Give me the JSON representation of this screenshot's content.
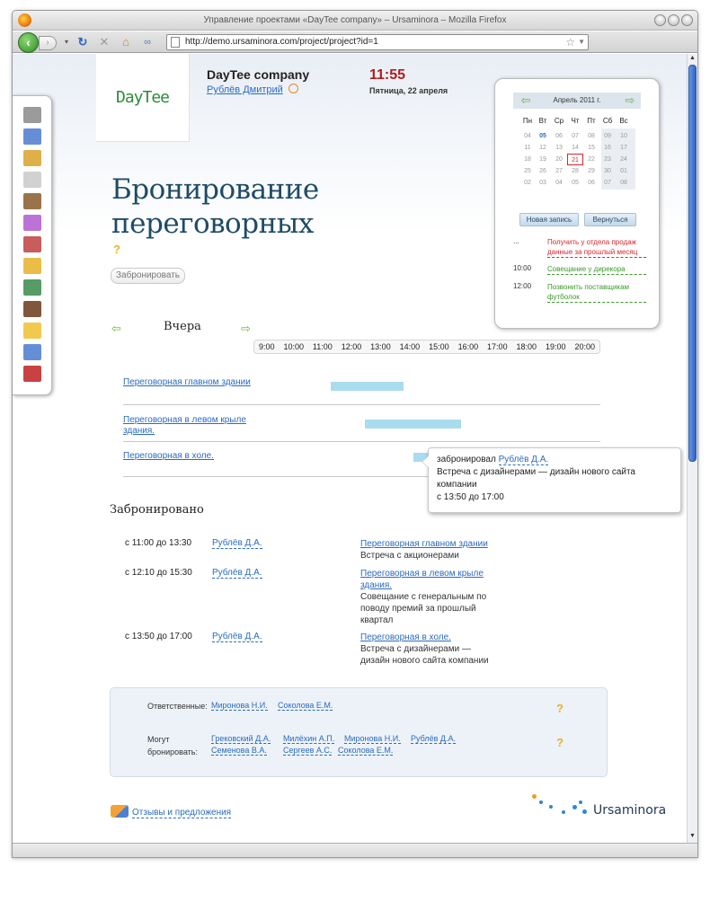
{
  "window": {
    "title": "Управление проектами «DayTee company» – Ursaminora – Mozilla Firefox",
    "url": "http://demo.ursaminora.com/project/project?id=1"
  },
  "header": {
    "logo": "DayTee",
    "company": "DayTee company",
    "user": "Рублёв Дмитрий",
    "time": "11:55",
    "date": "Пятница, 22 апреля"
  },
  "sidebar": {
    "icons": [
      "news-icon",
      "messages-icon",
      "users-icon",
      "document-icon",
      "books-icon",
      "coffee-icon",
      "truck-icon",
      "clipboard-icon",
      "binders-icon",
      "notebook-icon",
      "mail-icon",
      "contact-card-icon",
      "new-badge-icon"
    ]
  },
  "page": {
    "title": "Бронирование переговорных",
    "help": "?",
    "book_button": "Забронировать"
  },
  "schedule": {
    "day": "Вчера",
    "hours": [
      "9:00",
      "10:00",
      "11:00",
      "12:00",
      "13:00",
      "14:00",
      "15:00",
      "16:00",
      "17:00",
      "18:00",
      "19:00",
      "20:00"
    ],
    "rooms": [
      {
        "name": "Переговорная главном здании",
        "start": 11,
        "end": 13.5
      },
      {
        "name": "Переговорная в левом крыле здания.",
        "start": 12.17,
        "end": 15.5
      },
      {
        "name": "Переговорная в холе.",
        "start": 13.83,
        "end": 17
      }
    ]
  },
  "tooltip": {
    "prefix": "забронировал",
    "user": "Рублёв Д.А.",
    "text": "Встреча с дизайнерами — дизайн нового сайта компании",
    "time": "с 13:50 до 17:00"
  },
  "booked": {
    "title": "Забронировано",
    "items": [
      {
        "time": "с 11:00 до 13:30",
        "user": "Рублёв Д.А.",
        "room": "Переговорная главном здании",
        "desc": "Встреча с акционерами"
      },
      {
        "time": "с 12:10 до 15:30",
        "user": "Рублёв Д.А.",
        "room": "Переговорная в левом крыле здания.",
        "desc": "Совещание с генеральным по поводу премий за прошлый квартал"
      },
      {
        "time": "с 13:50 до 17:00",
        "user": "Рублёв Д.А.",
        "room": "Переговорная в холе.",
        "desc": "Встреча с дизайнерами — дизайн нового сайта компании"
      }
    ]
  },
  "permissions": {
    "responsible_label": "Ответственные:",
    "responsible": [
      "Миронова Н.И.",
      "Соколова Е.М."
    ],
    "can_book_label_1": "Могут",
    "can_book_label_2": "бронировать:",
    "can_book": [
      "Грековский Д.А.",
      "Милёхин А.П.",
      "Миронова Н.И.",
      "Рублёв Д.А.",
      "Семенова В.А.",
      "Сергеев А.С.",
      "Соколова Е.М."
    ],
    "help": "?"
  },
  "calendar": {
    "month": "Апрель 2011 г.",
    "dow": [
      "Пн",
      "Вт",
      "Ср",
      "Чт",
      "Пт",
      "Сб",
      "Вс"
    ],
    "weeks": [
      [
        "04",
        "05",
        "06",
        "07",
        "08",
        "09",
        "10"
      ],
      [
        "11",
        "12",
        "13",
        "14",
        "15",
        "16",
        "17"
      ],
      [
        "18",
        "19",
        "20",
        "21",
        "22",
        "23",
        "24"
      ],
      [
        "25",
        "26",
        "27",
        "28",
        "29",
        "30",
        "01"
      ],
      [
        "02",
        "03",
        "04",
        "05",
        "06",
        "07",
        "08"
      ]
    ],
    "today": "21",
    "new_button": "Новая запись",
    "back_button": "Вернуться",
    "events": [
      {
        "time": "...",
        "text": "Получить у отдела продаж данные за прошлый месяц",
        "color": "#d9262b"
      },
      {
        "time": "10:00",
        "text": "Совещание у дирекора",
        "color": "#3a9a2a"
      },
      {
        "time": "12:00",
        "text": "Позвонить поставщикам футболок",
        "color": "#3a9a2a"
      }
    ]
  },
  "footer": {
    "feedback": "Отзывы и предложения",
    "brand": "Ursaminora"
  }
}
